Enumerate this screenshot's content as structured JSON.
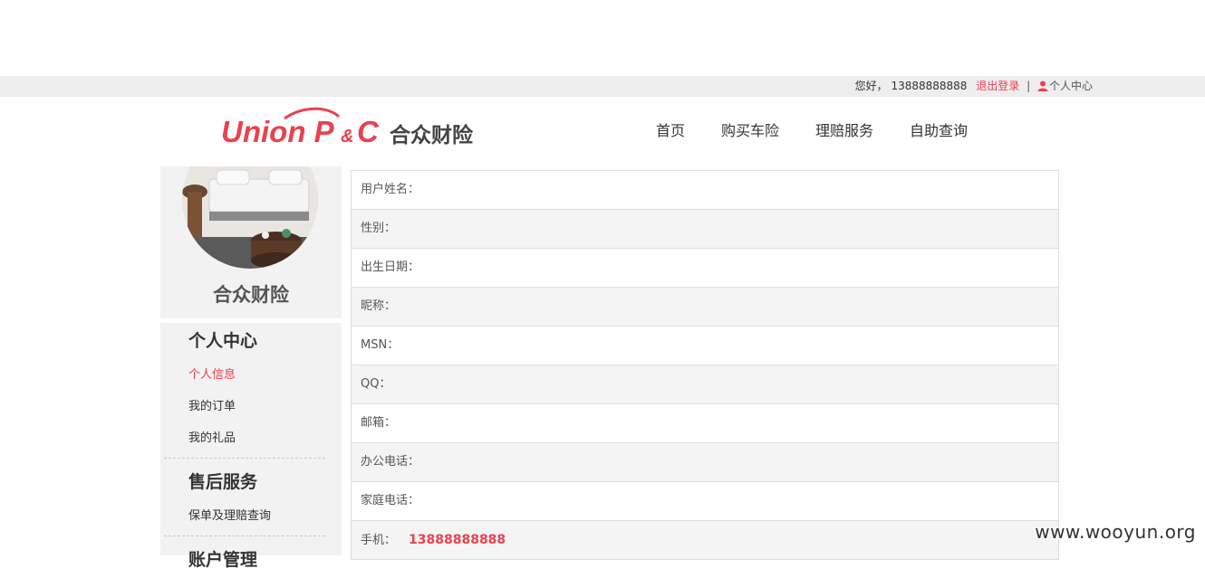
{
  "topbar": {
    "greeting": "您好，",
    "phone": "13888888888",
    "logout": "退出登录",
    "separator": "|",
    "personal_center": "个人中心"
  },
  "logo": {
    "text_en": "Union P&C",
    "text_cn": "合众财险",
    "brand_color": "#e8424f"
  },
  "nav": {
    "items": [
      "首页",
      "购买车险",
      "理赔服务",
      "自助查询"
    ]
  },
  "sidebar": {
    "brand": "合众财险",
    "groups": [
      {
        "title": "个人中心",
        "items": [
          "个人信息",
          "我的订单",
          "我的礼品"
        ]
      },
      {
        "title": "售后服务",
        "items": [
          "保单及理赔查询"
        ]
      },
      {
        "title": "账户管理",
        "items": []
      }
    ]
  },
  "profile": {
    "rows": [
      {
        "label": "用户姓名：",
        "value": ""
      },
      {
        "label": "性别：",
        "value": ""
      },
      {
        "label": "出生日期：",
        "value": ""
      },
      {
        "label": "昵称：",
        "value": ""
      },
      {
        "label": "MSN：",
        "value": ""
      },
      {
        "label": "QQ：",
        "value": ""
      },
      {
        "label": "邮箱：",
        "value": ""
      },
      {
        "label": "办公电话：",
        "value": ""
      },
      {
        "label": "家庭电话：",
        "value": ""
      },
      {
        "label": "手机：",
        "value": "13888888888"
      }
    ]
  },
  "watermark": "www.wooyun.org"
}
